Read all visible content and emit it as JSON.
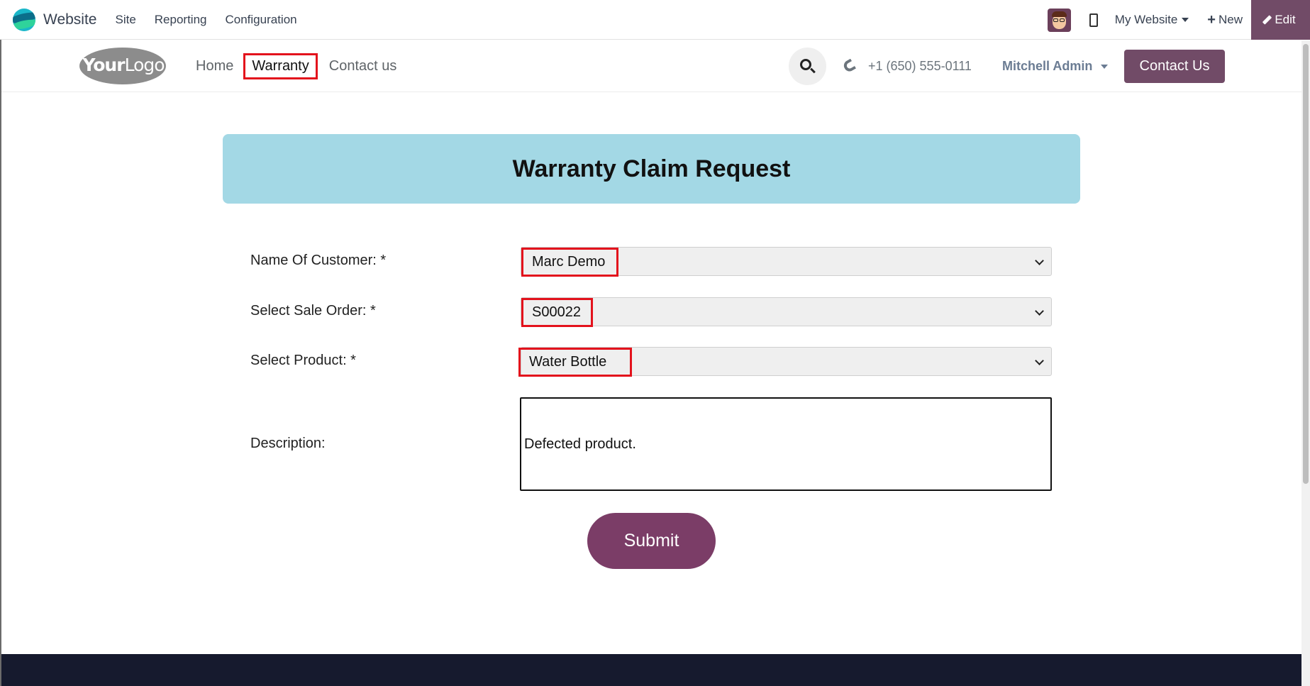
{
  "topbar": {
    "app_name": "Website",
    "menu": [
      "Site",
      "Reporting",
      "Configuration"
    ],
    "website_selector": "My Website",
    "new_label": "New",
    "edit_label": "Edit",
    "brand_color": "#714b67"
  },
  "header": {
    "logo_text_bold": "Your",
    "logo_text_light": "Logo",
    "nav": [
      {
        "label": "Home",
        "active": false
      },
      {
        "label": "Warranty",
        "active": true
      },
      {
        "label": "Contact us",
        "active": false
      }
    ],
    "phone": "+1 (650) 555-0111",
    "user": "Mitchell Admin",
    "contact_button": "Contact Us"
  },
  "banner": {
    "title": "Warranty Claim Request",
    "color": "#a3d8e5"
  },
  "form": {
    "customer_label": "Name Of Customer: *",
    "customer_value": "Marc Demo",
    "sale_order_label": "Select Sale Order: *",
    "sale_order_value": "S00022",
    "product_label": "Select Product: *",
    "product_value": "Water Bottle",
    "description_label": "Description:",
    "description_value": "Defected product.",
    "submit_label": "Submit",
    "highlight_color": "#e3121c"
  }
}
